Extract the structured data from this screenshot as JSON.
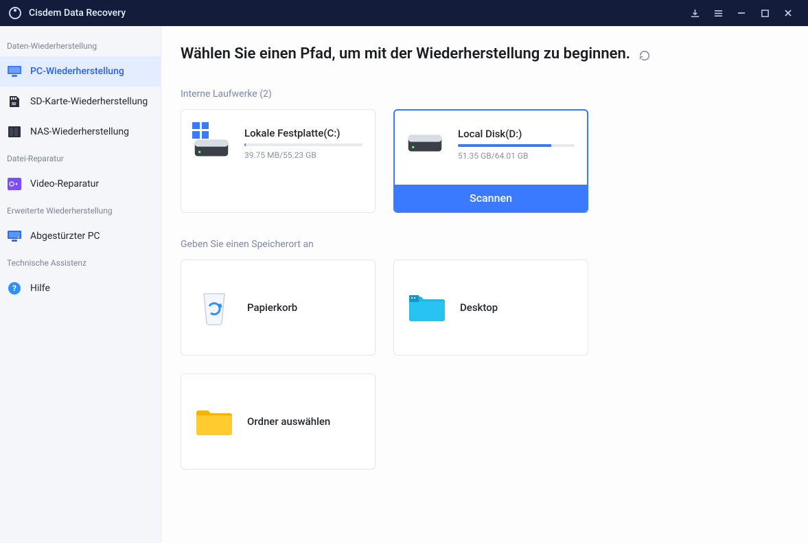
{
  "titlebar": {
    "app_name": "Cisdem Data Recovery"
  },
  "sidebar": {
    "sections": [
      {
        "label": "Daten-Wiederherstellung",
        "items": [
          {
            "label": "PC-Wiederherstellung",
            "active": true
          },
          {
            "label": "SD-Karte-Wiederherstellung"
          },
          {
            "label": "NAS-Wiederherstellung"
          }
        ]
      },
      {
        "label": "Datei-Reparatur",
        "items": [
          {
            "label": "Video-Reparatur"
          }
        ]
      },
      {
        "label": "Erweiterte Wiederherstellung",
        "items": [
          {
            "label": "Abgestürzter PC"
          }
        ]
      },
      {
        "label": "Technische Assistenz",
        "items": [
          {
            "label": "Hilfe"
          }
        ]
      }
    ]
  },
  "main": {
    "heading": "Wählen Sie einen Pfad, um mit der Wiederherstellung zu beginnen.",
    "drives_section_label": "Interne Laufwerke (2)",
    "drives": [
      {
        "name": "Lokale Festplatte(C:)",
        "size_text": "39.75 MB/55.23 GB",
        "fill_pct": 1,
        "selected": false,
        "system": true
      },
      {
        "name": "Local Disk(D:)",
        "size_text": "51.35 GB/64.01 GB",
        "fill_pct": 80,
        "selected": true,
        "system": false
      }
    ],
    "scan_button_label": "Scannen",
    "locations_section_label": "Geben Sie einen Speicherort an",
    "locations": [
      {
        "label": "Papierkorb",
        "icon": "recycle-bin"
      },
      {
        "label": "Desktop",
        "icon": "desktop-folder"
      },
      {
        "label": "Ordner auswählen",
        "icon": "plain-folder"
      }
    ]
  }
}
